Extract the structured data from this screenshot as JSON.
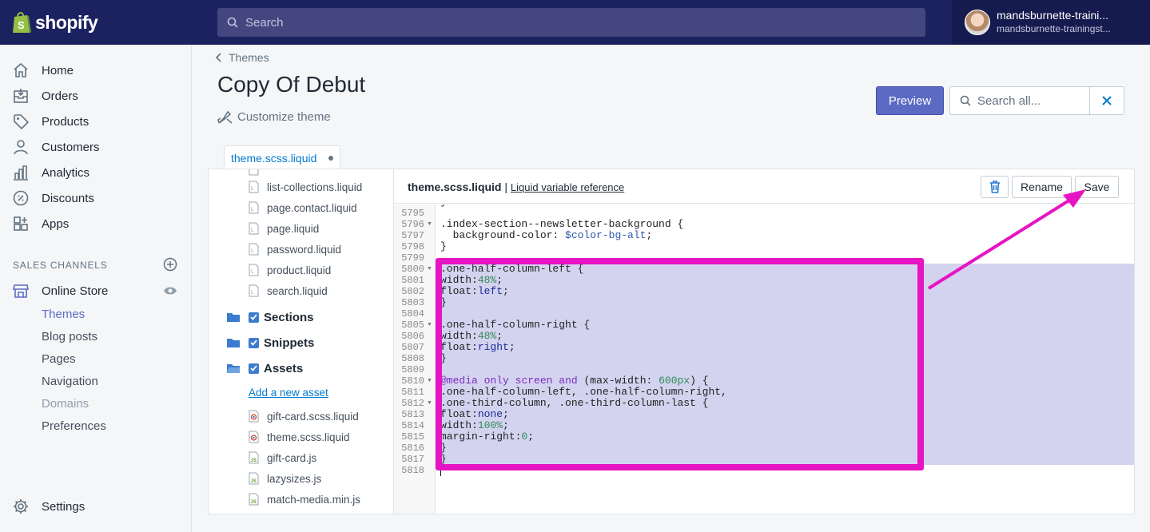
{
  "topbar": {
    "logo_text": "shopify",
    "search_placeholder": "Search",
    "user_name": "mandsburnette-traini...",
    "user_store": "mandsburnette-trainingst..."
  },
  "sidebar": {
    "items": [
      {
        "label": "Home",
        "icon": "home-icon"
      },
      {
        "label": "Orders",
        "icon": "orders-icon"
      },
      {
        "label": "Products",
        "icon": "tag-icon"
      },
      {
        "label": "Customers",
        "icon": "person-icon"
      },
      {
        "label": "Analytics",
        "icon": "bar-chart-icon"
      },
      {
        "label": "Discounts",
        "icon": "discount-icon"
      },
      {
        "label": "Apps",
        "icon": "apps-icon"
      }
    ],
    "sales_channels_title": "SALES CHANNELS",
    "online_store": "Online Store",
    "sub_items": [
      "Themes",
      "Blog posts",
      "Pages",
      "Navigation",
      "Domains",
      "Preferences"
    ],
    "settings": "Settings"
  },
  "main": {
    "breadcrumb": "Themes",
    "title": "Copy Of Debut",
    "customize": "Customize theme",
    "preview": "Preview",
    "search_placeholder": "Search all...",
    "tab_label": "theme.scss.liquid"
  },
  "filetree": {
    "templates": [
      "list-collections.liquid",
      "page.contact.liquid",
      "page.liquid",
      "password.liquid",
      "product.liquid",
      "search.liquid"
    ],
    "folders": [
      "Sections",
      "Snippets",
      "Assets"
    ],
    "add_asset": "Add a new asset",
    "assets": [
      "gift-card.scss.liquid",
      "theme.scss.liquid",
      "gift-card.js",
      "lazysizes.js",
      "match-media.min.js"
    ]
  },
  "editor": {
    "file_name": "theme.scss.liquid",
    "separator": " | ",
    "reference_link": "Liquid variable reference",
    "rename": "Rename",
    "save": "Save",
    "lines": [
      {
        "n": "5795",
        "t": ""
      },
      {
        "n": "5796",
        "t": ".index-section--newsletter-background {"
      },
      {
        "n": "5797",
        "t": "  background-color: $color-bg-alt;"
      },
      {
        "n": "5798",
        "t": "}"
      },
      {
        "n": "5799",
        "t": ""
      },
      {
        "n": "5800",
        "t": ".one-half-column-left {"
      },
      {
        "n": "5801",
        "t": "width:48%;"
      },
      {
        "n": "5802",
        "t": "float:left;"
      },
      {
        "n": "5803",
        "t": "}"
      },
      {
        "n": "5804",
        "t": ""
      },
      {
        "n": "5805",
        "t": ".one-half-column-right {"
      },
      {
        "n": "5806",
        "t": "width:48%;"
      },
      {
        "n": "5807",
        "t": "float:right;"
      },
      {
        "n": "5808",
        "t": "}"
      },
      {
        "n": "5809",
        "t": ""
      },
      {
        "n": "5810",
        "t": "@media only screen and (max-width: 600px) {"
      },
      {
        "n": "5811",
        "t": ".one-half-column-left, .one-half-column-right,"
      },
      {
        "n": "5812",
        "t": ".one-third-column, .one-third-column-last {"
      },
      {
        "n": "5813",
        "t": "float:none;"
      },
      {
        "n": "5814",
        "t": "width:100%;"
      },
      {
        "n": "5815",
        "t": "margin-right:0;"
      },
      {
        "n": "5816",
        "t": "}"
      },
      {
        "n": "5817",
        "t": "}"
      },
      {
        "n": "5818",
        "t": ""
      }
    ]
  },
  "colors": {
    "topbar": "#1c2260",
    "accent": "#5c6ac4",
    "highlight_box": "#e614c3",
    "selection": "#d4d3ef"
  }
}
